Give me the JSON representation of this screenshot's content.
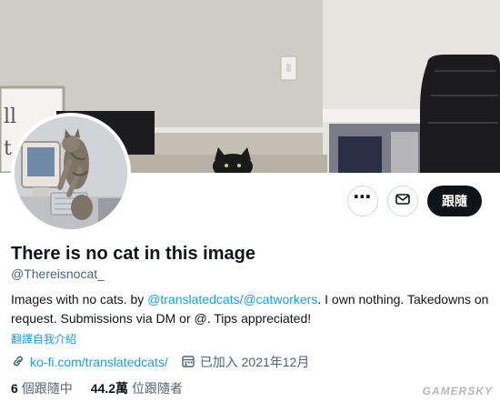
{
  "profile": {
    "name": "There is no cat in this image",
    "handle": "@Thereisnocat_",
    "bio_prefix": "Images with no cats. by ",
    "bio_link1": "@translatedcats",
    "bio_sep": "/",
    "bio_link2": "@catworkers",
    "bio_suffix": ". I own nothing. Takedowns on request. Submissions via DM or @. Tips appreciated!",
    "translate_label": "翻譯自我介紹",
    "website": "ko-fi.com/translatedcats/",
    "joined": "已加入 2021年12月"
  },
  "actions": {
    "follow_label": "跟隨"
  },
  "stats": {
    "following_count": "6",
    "following_label": "個跟隨中",
    "followers_count": "44.2萬",
    "followers_label": "位跟隨者"
  },
  "watermark": "GAMERSKY",
  "icons": [
    "more-icon",
    "mail-icon",
    "link-icon",
    "calendar-icon"
  ],
  "colors": {
    "accent": "#1d9bf0",
    "text": "#0f1419",
    "muted": "#536471",
    "follow_bg": "#0f1419"
  }
}
